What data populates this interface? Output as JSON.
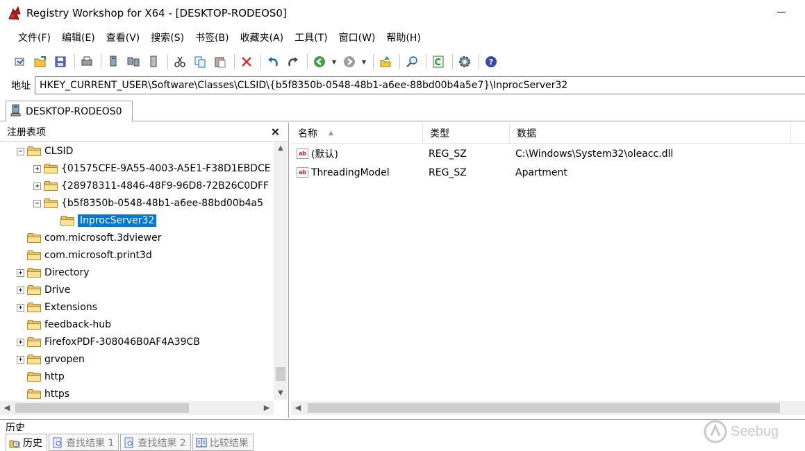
{
  "window": {
    "title": "Registry Workshop for X64 - [DESKTOP-RODEOS0]"
  },
  "menu": [
    "文件(F)",
    "编辑(E)",
    "查看(V)",
    "搜索(S)",
    "书签(B)",
    "收藏夹(A)",
    "工具(T)",
    "窗口(W)",
    "帮助(H)"
  ],
  "toolbar": {
    "icons": [
      "connect-registry-icon",
      "open-icon",
      "save-icon",
      "print-icon",
      "local-registry-icon",
      "network-registry-icon",
      "offline-registry-icon",
      "cut-icon",
      "copy-icon",
      "paste-icon",
      "delete-icon",
      "undo-icon",
      "redo-icon",
      "back-icon",
      "forward-icon",
      "go-up-icon",
      "find-icon",
      "refresh-icon",
      "options-icon",
      "help-icon"
    ]
  },
  "address": {
    "label": "地址",
    "value": "HKEY_CURRENT_USER\\Software\\Classes\\CLSID\\{b5f8350b-0548-48b1-a6ee-88bd00b4a5e7}\\InprocServer32"
  },
  "session_tab": {
    "label": "DESKTOP-RODEOS0"
  },
  "tree_panel": {
    "title": "注册表项",
    "close_glyph": "×",
    "items": [
      {
        "label": "CLSID",
        "expander": "−",
        "selected": false
      },
      {
        "label": "{01575CFE-9A55-4003-A5E1-F38D1EBDCE",
        "expander": "+",
        "selected": false
      },
      {
        "label": "{28978311-4846-48F9-96D8-72B26C0DFF",
        "expander": "+",
        "selected": false
      },
      {
        "label": "{b5f8350b-0548-48b1-a6ee-88bd00b4a5",
        "expander": "−",
        "selected": false
      },
      {
        "label": "InprocServer32",
        "expander": "",
        "selected": true
      },
      {
        "label": "com.microsoft.3dviewer",
        "expander": "",
        "selected": false
      },
      {
        "label": "com.microsoft.print3d",
        "expander": "",
        "selected": false
      },
      {
        "label": "Directory",
        "expander": "+",
        "selected": false
      },
      {
        "label": "Drive",
        "expander": "+",
        "selected": false
      },
      {
        "label": "Extensions",
        "expander": "+",
        "selected": false
      },
      {
        "label": "feedback-hub",
        "expander": "",
        "selected": false
      },
      {
        "label": "FirefoxPDF-308046B0AF4A39CB",
        "expander": "+",
        "selected": false
      },
      {
        "label": "grvopen",
        "expander": "+",
        "selected": false
      },
      {
        "label": "http",
        "expander": "",
        "selected": false
      },
      {
        "label": "https",
        "expander": "",
        "selected": false
      }
    ]
  },
  "values_list": {
    "columns": [
      "名称",
      "类型",
      "数据"
    ],
    "rows": [
      {
        "name": "(默认)",
        "type": "REG_SZ",
        "data": "C:\\Windows\\System32\\oleacc.dll"
      },
      {
        "name": "ThreadingModel",
        "type": "REG_SZ",
        "data": "Apartment"
      }
    ]
  },
  "bottom": {
    "title": "历史",
    "tabs": [
      "历史",
      "查找结果 1",
      "查找结果 2",
      "比较结果"
    ]
  },
  "watermark": "Seebug",
  "colors": {
    "selection": "#0078d7",
    "folder": "#e9c46a"
  }
}
